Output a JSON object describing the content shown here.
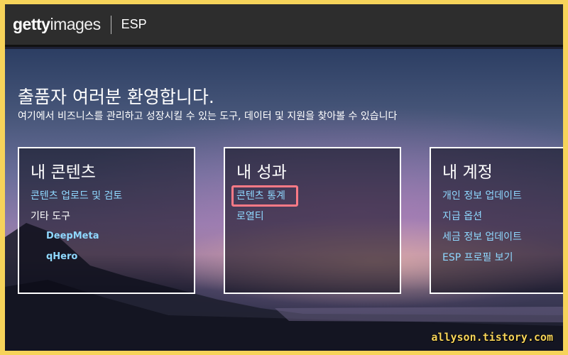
{
  "header": {
    "logo_bold": "getty",
    "logo_light": "images",
    "section": "ESP"
  },
  "hero": {
    "title": "출품자 여러분 환영합니다.",
    "subtitle": "여기에서 비즈니스를 관리하고 성장시킬 수 있는 도구, 데이터 및 지원을 찾아볼 수 있습니다"
  },
  "cards": {
    "content": {
      "title": "내 콘텐츠",
      "upload_link": "콘텐츠 업로드 및 검토",
      "other_tools": "기타 도구",
      "tool1": "DeepMeta",
      "tool2": "qHero"
    },
    "performance": {
      "title": "내 성과",
      "stats_link": "콘텐츠 통계",
      "royalty_link": "로열티"
    },
    "account": {
      "title": "내 계정",
      "personal_info": "개인 정보 업데이트",
      "payment": "지급 옵션",
      "tax_info": "세금 정보 업데이트",
      "profile": "ESP 프로필 보기"
    }
  },
  "watermark": "allyson.tistory.com",
  "colors": {
    "link": "#8fd8ff",
    "highlight": "#ff7a86",
    "page_border": "#f6d35a",
    "topbar": "#2d2d2d"
  }
}
